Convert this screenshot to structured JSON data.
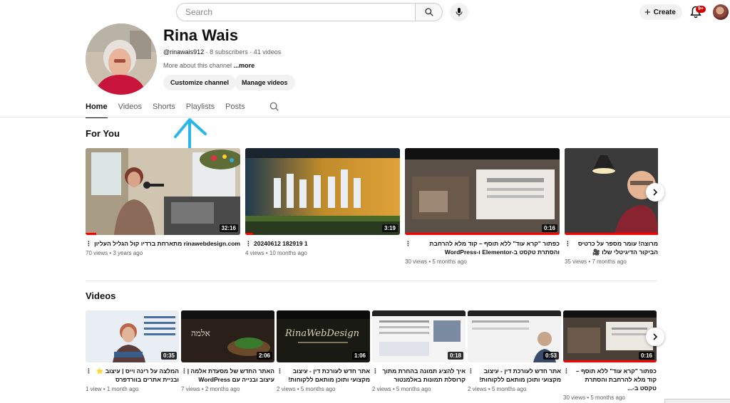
{
  "header": {
    "search_placeholder": "Search",
    "create_label": "Create",
    "notification_badge": "9+"
  },
  "channel": {
    "name": "Rina Wais",
    "handle": "@rinawais912",
    "subscribers": "8 subscribers",
    "videos_count": "41 videos",
    "separator": " · ",
    "about": "More about this channel",
    "more": "...more",
    "customize_label": "Customize channel",
    "manage_label": "Manage videos"
  },
  "tabs": [
    {
      "label": "Home",
      "active": true
    },
    {
      "label": "Videos",
      "active": false
    },
    {
      "label": "Shorts",
      "active": false
    },
    {
      "label": "Playlists",
      "active": false
    },
    {
      "label": "Posts",
      "active": false
    }
  ],
  "for_you": {
    "title": "For You",
    "cards": [
      {
        "title": "rinawebdesign.com מתארחת ברדיו קול הגליל העליון",
        "meta": "70 views • 3 years ago",
        "duration": "32:16",
        "progress": 0.07,
        "ltr": false
      },
      {
        "title": "20240612 182919 1",
        "meta": "4 views • 10 months ago",
        "duration": "3:19",
        "progress": 0.05,
        "ltr": true
      },
      {
        "title": "כפתור \"קרא עוד\" ללא תוסף – קוד מלא להרחבת והסתרת טקסט ב-Elementor ו-WordPress",
        "meta": "30 views • 5 months ago",
        "duration": "0:16",
        "progress": 1.0,
        "ltr": false
      },
      {
        "title": "מרוצה! עומר מספר על כרטיס הביקור הדיגיטלי שלו 🎥",
        "meta": "35 views • 7 months ago",
        "duration": "",
        "progress": 1.0,
        "ltr": false
      }
    ]
  },
  "videos": {
    "title": "Videos",
    "cards": [
      {
        "title": "המלצה על רינה וייס | עיצוב ⭐ ובניית אתרים בוורדפרס",
        "meta": "1 view • 1 month ago",
        "duration": "0:35",
        "progress": 0
      },
      {
        "title": "האתר החדש של מסעדת אלמה | עיצוב ובנייה עם WordPress",
        "meta": "7 views • 2 months ago",
        "duration": "2:06",
        "progress": 0
      },
      {
        "title": "אתר חדש לעורכת דין - עיצוב מקצועי ותוכן מותאם ללקוחות!",
        "meta": "2 views • 5 months ago",
        "duration": "1:06",
        "progress": 0
      },
      {
        "title": "איך להציג תמונה בהחרת מתוך קרוסלת תמונות באלמנטור",
        "meta": "2 views • 5 months ago",
        "duration": "0:18",
        "progress": 0
      },
      {
        "title": "אתר חדש לעורכת דין - עיצוב מקצועי ותוכן מותאם ללקוחות!",
        "meta": "2 views • 5 months ago",
        "duration": "0:53",
        "progress": 0
      },
      {
        "title": "כפתור \"קרא עוד\" ללא תוסף – קוד מלא להרחבת והסתרת טקסט ב-...",
        "meta": "30 views • 5 months ago",
        "duration": "0:16",
        "progress": 1.0
      }
    ]
  },
  "colors": {
    "progress": "#ff0000",
    "annotation_arrow": "#29b6e8",
    "text_primary": "#0f0f0f",
    "text_secondary": "#606060"
  },
  "icons": [
    "search-icon",
    "mic-icon",
    "plus-icon",
    "bell-icon",
    "kebab-icon",
    "chevron-right-icon",
    "arrow-annotation-icon"
  ]
}
